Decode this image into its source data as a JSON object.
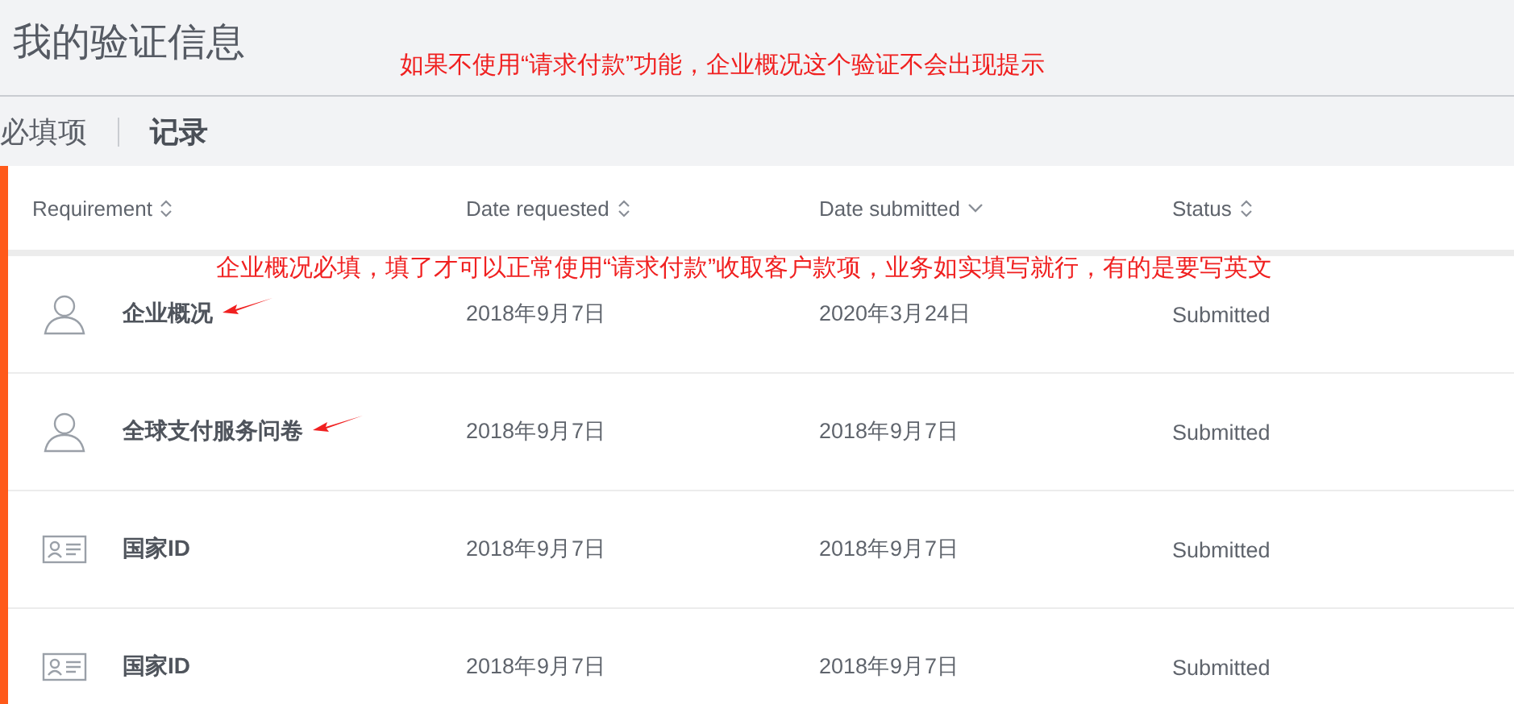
{
  "page_title": "我的验证信息",
  "notes": [
    {
      "text": "如果不使用“请求付款”功能，企业概况这个验证不会出现提示"
    },
    {
      "text": "企业概况必填，填了才可以正常使用“请求付款”收取客户款项，业务如实填写就行，有的是要写英文"
    }
  ],
  "tabs": [
    {
      "label": "必填项",
      "selected": false
    },
    {
      "label": "记录",
      "selected": true
    }
  ],
  "table": {
    "columns": [
      {
        "label": "Requirement",
        "sorted": false
      },
      {
        "label": "Date requested",
        "sorted": false
      },
      {
        "label": "Date submitted",
        "sorted": true
      },
      {
        "label": "Status",
        "sorted": false
      }
    ],
    "rows": [
      {
        "kind": "person",
        "requirement": "企业概况",
        "date_requested": "2018年9月7日",
        "date_submitted": "2020年3月24日",
        "status": "Submitted",
        "arrow": true
      },
      {
        "kind": "person",
        "requirement": "全球支付服务问卷",
        "date_requested": "2018年9月7日",
        "date_submitted": "2018年9月7日",
        "status": "Submitted",
        "arrow": true
      },
      {
        "kind": "id",
        "requirement": "国家ID",
        "date_requested": "2018年9月7日",
        "date_submitted": "2018年9月7日",
        "status": "Submitted",
        "arrow": false
      },
      {
        "kind": "id",
        "requirement": "国家ID",
        "date_requested": "2018年9月7日",
        "date_submitted": "2018年9月7日",
        "status": "Submitted",
        "arrow": false
      }
    ]
  }
}
